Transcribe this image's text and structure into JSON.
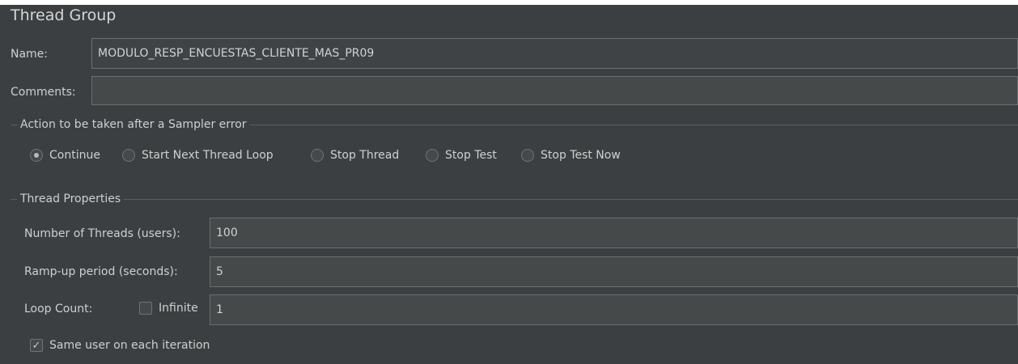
{
  "panel": {
    "title": "Thread Group"
  },
  "name_row": {
    "label": "Name:",
    "value": "MODULO_RESP_ENCUESTAS_CLIENTE_MAS_PR09"
  },
  "comments_row": {
    "label": "Comments:",
    "value": ""
  },
  "sampler_error": {
    "legend": "Action to be taken after a Sampler error",
    "options": [
      {
        "label": "Continue",
        "selected": true
      },
      {
        "label": "Start Next Thread Loop",
        "selected": false
      },
      {
        "label": "Stop Thread",
        "selected": false
      },
      {
        "label": "Stop Test",
        "selected": false
      },
      {
        "label": "Stop Test Now",
        "selected": false
      }
    ]
  },
  "thread_properties": {
    "legend": "Thread Properties",
    "num_threads": {
      "label": "Number of Threads (users):",
      "value": "100"
    },
    "ramp_up": {
      "label": "Ramp-up period (seconds):",
      "value": "5"
    },
    "loop_count": {
      "label": "Loop Count:",
      "infinite_label": "Infinite",
      "infinite_checked": false,
      "value": "1"
    },
    "same_user": {
      "label": "Same user on each iteration",
      "checked": true
    }
  },
  "colors": {
    "background": "#3c3f41",
    "field": "#45494a",
    "border": "#6b6f71",
    "text": "#cfcfcf"
  }
}
